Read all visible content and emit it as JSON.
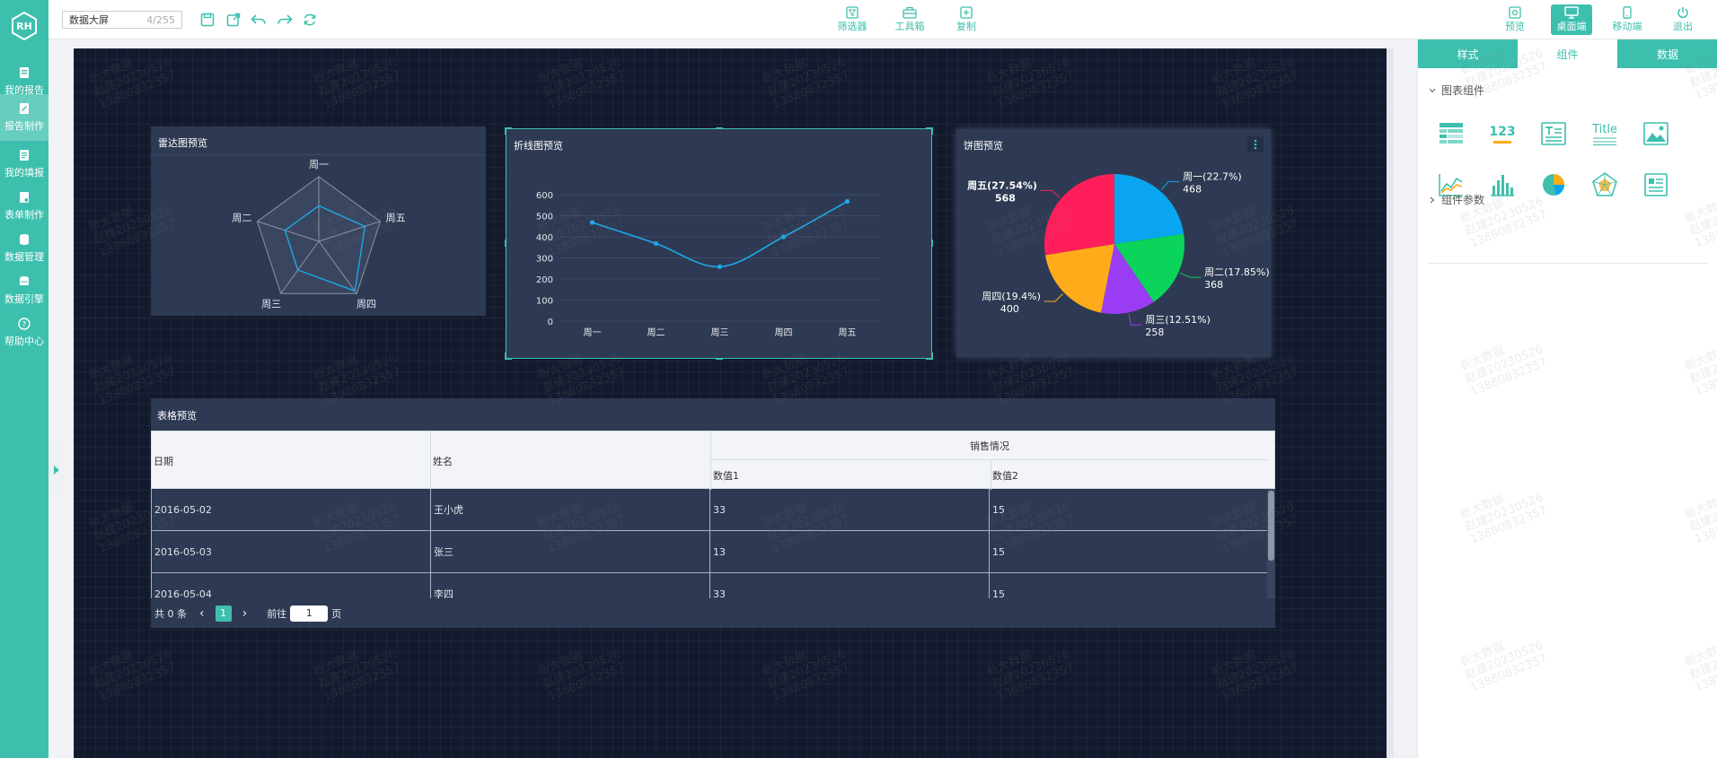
{
  "sidebar": {
    "items": [
      {
        "label": "我的报告",
        "icon": "report-icon"
      },
      {
        "label": "报告制作",
        "icon": "edit-report-icon",
        "active": true
      },
      {
        "label": "我的填报",
        "icon": "fill-icon"
      },
      {
        "label": "表单制作",
        "icon": "form-icon"
      },
      {
        "label": "数据管理",
        "icon": "database-icon"
      },
      {
        "label": "数据引擎",
        "icon": "engine-icon"
      },
      {
        "label": "帮助中心",
        "icon": "help-icon"
      }
    ]
  },
  "toolbar": {
    "name_value": "数据大屏",
    "name_count": "4/255",
    "mid_tools": [
      "筛选器",
      "工具箱",
      "复制"
    ],
    "right_tools": [
      "预览",
      "桌面端",
      "移动端",
      "退出"
    ],
    "active_right_tool": "桌面端"
  },
  "canvas": {
    "radar": {
      "title": "雷达图预览",
      "indicators": [
        "周一",
        "周五",
        "周四",
        "周三",
        "周二"
      ]
    },
    "line": {
      "title": "折线图预览"
    },
    "pie": {
      "title": "饼图预览",
      "menu_icon": "more-vertical-icon"
    },
    "table": {
      "title": "表格预览",
      "headers": {
        "date": "日期",
        "name": "姓名",
        "group": "销售情况",
        "v1": "数值1",
        "v2": "数值2"
      },
      "rows": [
        {
          "date": "2016-05-02",
          "name": "王小虎",
          "v1": "33",
          "v2": "15"
        },
        {
          "date": "2016-05-03",
          "name": "张三",
          "v1": "13",
          "v2": "15"
        },
        {
          "date": "2016-05-04",
          "name": "李四",
          "v1": "33",
          "v2": "15"
        }
      ],
      "pagination": {
        "total": "共 0 条",
        "current_page": "1",
        "goto_prefix": "前往",
        "goto_value": "1",
        "goto_suffix": "页"
      }
    }
  },
  "chart_data": [
    {
      "type": "radar",
      "title": "雷达图预览",
      "indicators": [
        "周一",
        "周五",
        "周四",
        "周三",
        "周二"
      ],
      "series": [
        {
          "values": [
            0.55,
            0.75,
            0.95,
            0.55,
            0.55
          ]
        }
      ],
      "rings": 5
    },
    {
      "type": "line",
      "title": "折线图预览",
      "categories": [
        "周一",
        "周二",
        "周三",
        "周四",
        "周五"
      ],
      "values": [
        468,
        368,
        258,
        400,
        568
      ],
      "ylim": [
        0,
        600
      ],
      "yticks": [
        0,
        100,
        200,
        300,
        400,
        500,
        600
      ],
      "smooth": true,
      "color": "#1ea7ea"
    },
    {
      "type": "pie",
      "title": "饼图预览",
      "slices": [
        {
          "name": "周一",
          "value": 468,
          "percent": "22.7%",
          "color": "#0aa5f0"
        },
        {
          "name": "周二",
          "value": 368,
          "percent": "17.85%",
          "color": "#0ad45a"
        },
        {
          "name": "周三",
          "value": 258,
          "percent": "12.51%",
          "color": "#9b3cf5"
        },
        {
          "name": "周四",
          "value": 400,
          "percent": "19.4%",
          "color": "#ffab1a"
        },
        {
          "name": "周五",
          "value": 568,
          "percent": "27.54%",
          "color": "#ff1e5a"
        }
      ]
    }
  ],
  "rightpanel": {
    "tabs": [
      "样式",
      "组件",
      "数据"
    ],
    "active_tab": "组件",
    "section_chart": "图表组件",
    "section_params": "组件参数",
    "components": [
      {
        "icon": "table-component-icon"
      },
      {
        "icon": "number-component-icon",
        "text": "123"
      },
      {
        "icon": "text-component-icon"
      },
      {
        "icon": "title-component-icon",
        "text": "Title"
      },
      {
        "icon": "image-component-icon"
      },
      {
        "icon": "line-chart-component-icon"
      },
      {
        "icon": "bar-chart-component-icon"
      },
      {
        "icon": "pie-chart-component-icon"
      },
      {
        "icon": "radar-chart-component-icon"
      },
      {
        "icon": "card-component-icon"
      }
    ]
  },
  "watermark": [
    "新大数据",
    "赵建20230526",
    "13880832357"
  ],
  "colors": {
    "brand": "#3dbfae",
    "canvas_bg": "#141a2e",
    "panel_bg": "#2e3a53",
    "line": "#1ea7ea"
  }
}
